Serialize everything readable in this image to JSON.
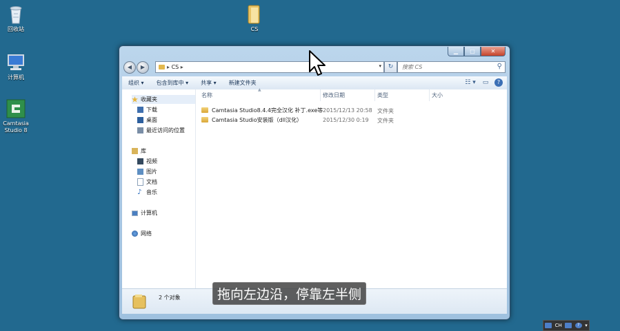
{
  "desktop": {
    "icons": [
      {
        "label": "回收站",
        "icon": "recycle-bin-icon"
      },
      {
        "label": "CS",
        "icon": "folder-icon"
      },
      {
        "label": "计算机",
        "icon": "computer-icon"
      },
      {
        "label": "Camtasia Studio 8",
        "icon": "camtasia-icon"
      }
    ]
  },
  "window": {
    "breadcrumb": [
      "CS"
    ],
    "search_placeholder": "搜索 CS",
    "toolbar": {
      "organize": "组织 ▾",
      "include_library": "包含到库中 ▾",
      "share": "共享 ▾",
      "new_folder": "新建文件夹"
    },
    "nav": {
      "favorites": "收藏夹",
      "downloads": "下载",
      "desktop": "桌面",
      "recent": "最近访问的位置",
      "libraries": "库",
      "videos": "视频",
      "pictures": "图片",
      "documents": "文档",
      "music": "音乐",
      "computer": "计算机",
      "network": "网络"
    },
    "columns": {
      "name": "名称",
      "modified": "修改日期",
      "type": "类型",
      "size": "大小"
    },
    "files": [
      {
        "name": "Camtasia Studio8.4.4完全汉化 补丁.exe等",
        "modified": "2015/12/13 20:58",
        "type": "文件夹"
      },
      {
        "name": "Camtasia Studio安装版（dll汉化）",
        "modified": "2015/12/30 0:19",
        "type": "文件夹"
      }
    ],
    "status": "2 个对象"
  },
  "subtitle": "拖向左边沿，停靠左半侧",
  "tray": {
    "lang": "CH"
  },
  "colors": {
    "desktop": "#22698f",
    "folder": "#e2b84e",
    "close": "#c5432a"
  }
}
